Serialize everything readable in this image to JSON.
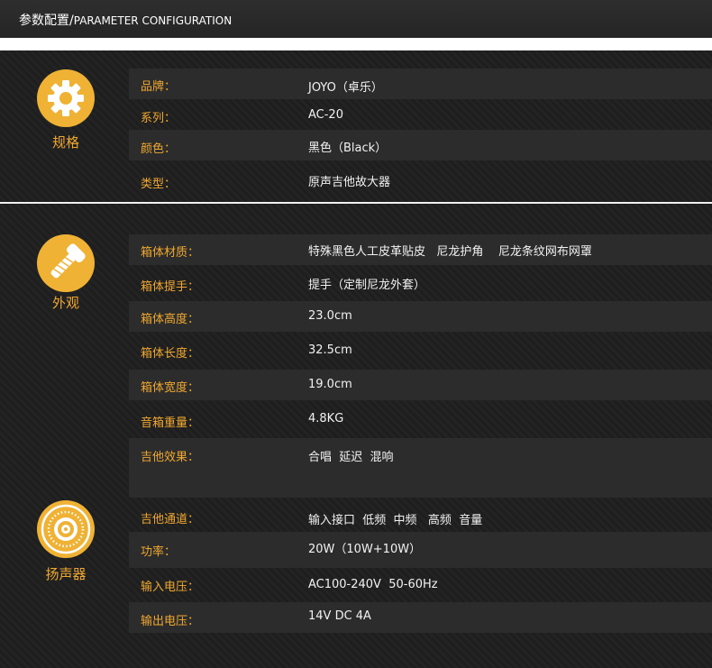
{
  "header": {
    "title_cn": "参数配置/",
    "title_en": "PARAMETER CONFIGURATION"
  },
  "sections": {
    "spec": {
      "title": "规格",
      "icon": "gear-icon",
      "rows": [
        {
          "label": "品牌：",
          "value": "JOYO（卓乐）"
        },
        {
          "label": "系列：",
          "value": "AC-20"
        },
        {
          "label": "颜色：",
          "value": "黑色（Black）"
        },
        {
          "label": "类型：",
          "value": "原声吉他故大器"
        }
      ]
    },
    "appearance": {
      "title": "外观",
      "icon": "bolt-icon",
      "rows": [
        {
          "label": "箱体材质：",
          "value": "特殊黑色人工皮革贴皮   尼龙护角    尼龙条纹网布网罩"
        },
        {
          "label": "箱体提手：",
          "value": "提手（定制尼龙外套）"
        },
        {
          "label": "箱体高度：",
          "value": "23.0cm"
        },
        {
          "label": "箱体长度：",
          "value": "32.5cm"
        },
        {
          "label": "箱体宽度：",
          "value": "19.0cm"
        },
        {
          "label": "音箱重量：",
          "value": "4.8KG"
        },
        {
          "label": "吉他效果：",
          "value": "合唱  延迟  混响"
        }
      ]
    },
    "speaker": {
      "title": "扬声器",
      "icon": "speaker-icon",
      "rows": [
        {
          "label": "吉他通道：",
          "value": "输入接口  低频  中频   高频  音量"
        },
        {
          "label": "功率：",
          "value": "20W（10W+10W）"
        },
        {
          "label": "输入电压：",
          "value": "AC100-240V  50-60Hz"
        },
        {
          "label": "输出电压：",
          "value": "14V DC 4A"
        }
      ]
    }
  },
  "colors": {
    "accent": "#f0a830",
    "row_dark": "#2c2c2c",
    "background": "#1b1b1b"
  }
}
